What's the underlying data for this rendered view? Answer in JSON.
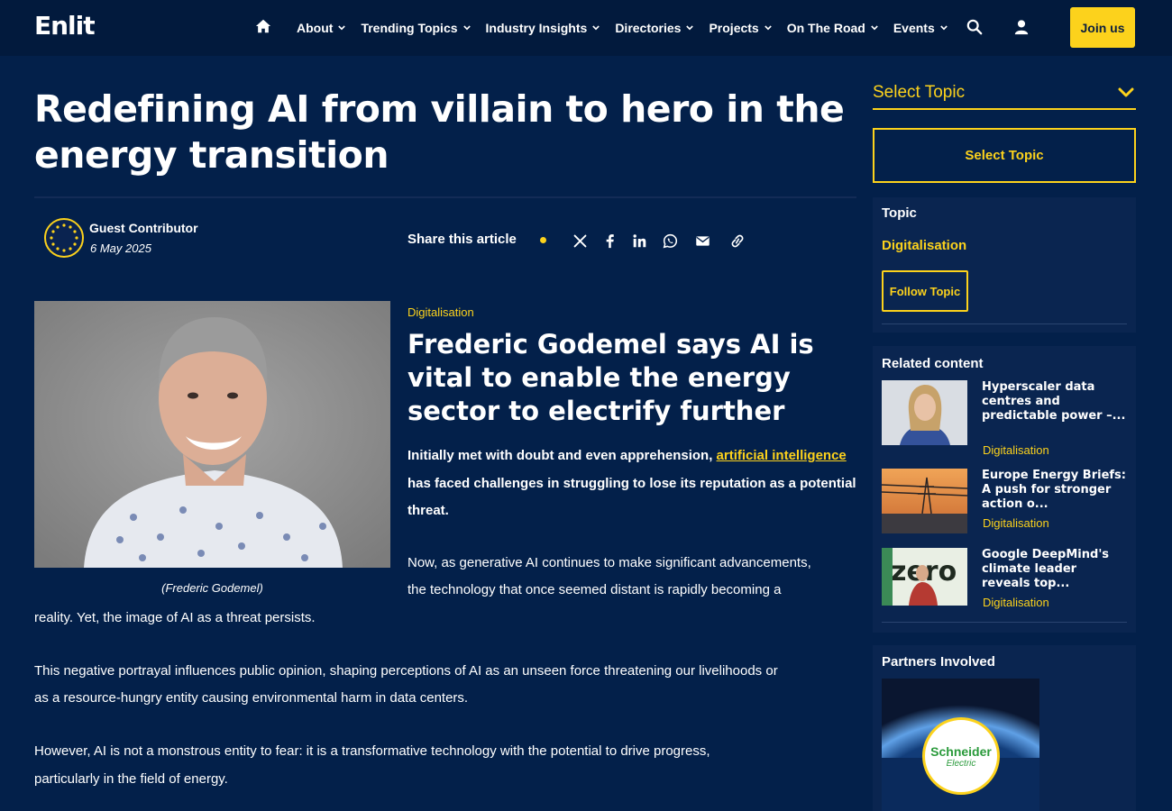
{
  "nav": {
    "logo": "Enlit",
    "items": [
      {
        "label": "About"
      },
      {
        "label": "Trending Topics"
      },
      {
        "label": "Industry Insights"
      },
      {
        "label": "Directories"
      },
      {
        "label": "Projects"
      },
      {
        "label": "On The Road"
      },
      {
        "label": "Events"
      }
    ],
    "join_label": "Join us"
  },
  "article": {
    "title": "Redefining AI from villain to hero in the energy transition",
    "author": "Guest Contributor",
    "date": "6 May 2025",
    "share_label": "Share this article",
    "image_caption": "(Frederic Godemel)",
    "kicker": "Digitalisation",
    "standfirst": "Frederic Godemel says AI is vital to enable the energy sector to electrify further",
    "intro_before": "Initially met with doubt and even apprehension, ",
    "intro_link": "artificial intelligence",
    "intro_after": " has faced challenges in struggling to lose its reputation as a potential threat.",
    "para1_line1": "Now, as generative AI continues to make significant advancements,",
    "para1_line2": "the technology that once seemed distant is rapidly becoming a",
    "para1_line3": "reality. Yet, the image of AI as a threat persists.",
    "para2_line1": "This negative portrayal influences public opinion, shaping perceptions of AI as an unseen force threatening our livelihoods or",
    "para2_line2": "as a resource-hungry entity causing environmental harm in data centers.",
    "para3_line1": "However, AI is not a monstrous entity to fear: it is a transformative technology with the potential to drive progress,",
    "para3_line2": "particularly in the field of energy."
  },
  "sidebar": {
    "select_label": "Select Topic",
    "select_box_label": "Select Topic",
    "topic_heading": "Topic",
    "topic_name": "Digitalisation",
    "follow_label": "Follow Topic",
    "related_heading": "Related content",
    "related": [
      {
        "title": "Hyperscaler data centres and predictable power –...",
        "tag": "Digitalisation"
      },
      {
        "title": "Europe Energy Briefs: A push for stronger action o...",
        "tag": "Digitalisation"
      },
      {
        "title": "Google DeepMind's climate leader reveals top...",
        "tag": "Digitalisation"
      }
    ],
    "partners_heading": "Partners Involved",
    "partner_logo_line1": "Schneider",
    "partner_logo_line2": "Electric"
  },
  "colors": {
    "accent": "#fcd21c",
    "background": "#03204a",
    "nav": "#021a3d"
  },
  "icons": [
    "home-icon",
    "chevron-down-icon",
    "search-icon",
    "user-icon",
    "x-icon",
    "facebook-icon",
    "linkedin-icon",
    "whatsapp-icon",
    "email-icon",
    "link-icon"
  ]
}
